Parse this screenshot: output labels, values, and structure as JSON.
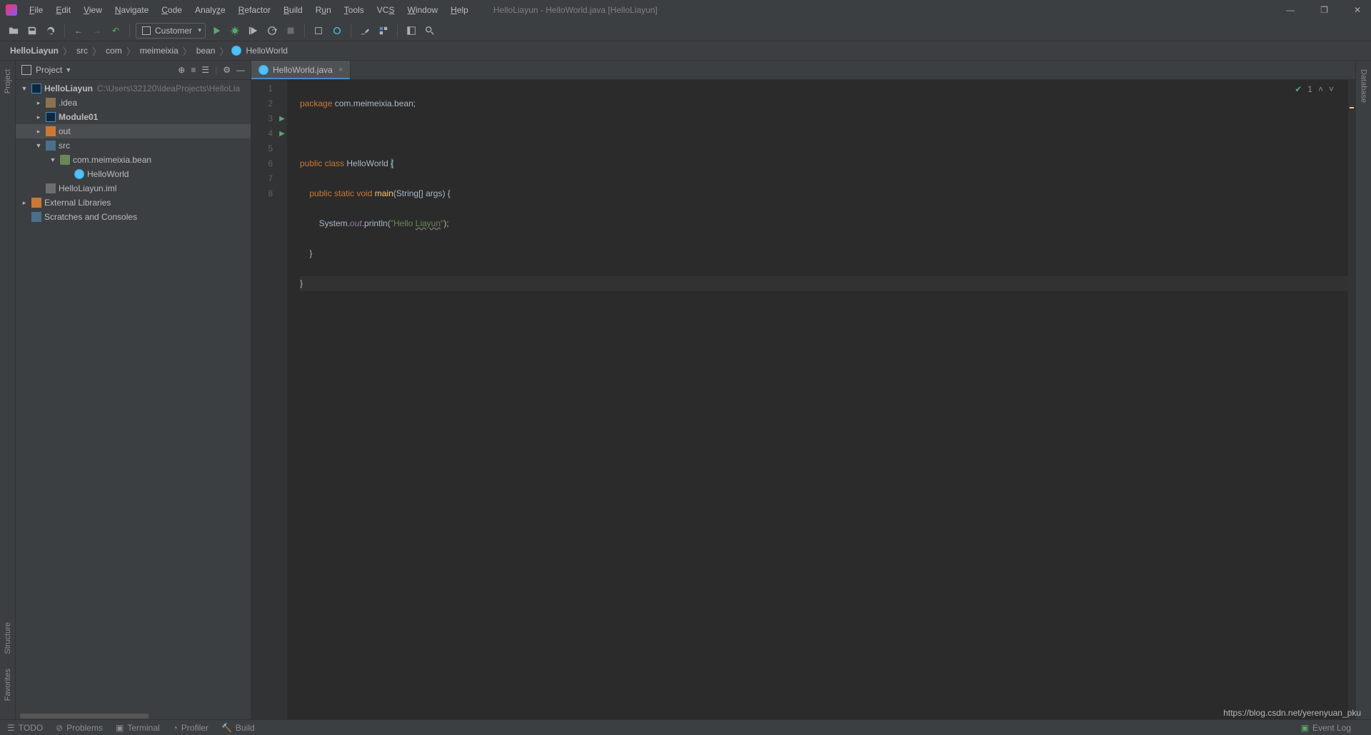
{
  "title": "HelloLiayun - HelloWorld.java [HelloLiayun]",
  "menu": [
    "File",
    "Edit",
    "View",
    "Navigate",
    "Code",
    "Analyze",
    "Refactor",
    "Build",
    "Run",
    "Tools",
    "VCS",
    "Window",
    "Help"
  ],
  "run_config": "Customer",
  "breadcrumbs": [
    "HelloLiayun",
    "src",
    "com",
    "meimeixia",
    "bean",
    "HelloWorld"
  ],
  "project_panel": {
    "title": "Project",
    "tree": {
      "root": {
        "name": "HelloLiayun",
        "path": "C:\\Users\\32120\\IdeaProjects\\HelloLia"
      },
      "idea": ".idea",
      "module01": "Module01",
      "out": "out",
      "src": "src",
      "pkg": "com.meimeixia.bean",
      "cls": "HelloWorld",
      "iml": "HelloLiayun.iml",
      "ext": "External Libraries",
      "scratch": "Scratches and Consoles"
    }
  },
  "tab": {
    "name": "HelloWorld.java"
  },
  "code": {
    "lines": [
      "1",
      "2",
      "3",
      "4",
      "5",
      "6",
      "7",
      "8"
    ],
    "l1_kw": "package",
    "l1_pkg": " com.meimeixia.bean",
    "l1_s": ";",
    "l3_kw1": "public class ",
    "l3_cls": "HelloWorld ",
    "l3_b": "{",
    "l4_ind": "    ",
    "l4_kw": "public static void ",
    "l4_m": "main",
    "l4_p": "(String[] args) {",
    "l5_ind": "        ",
    "l5_a": "System.",
    "l5_out": "out",
    "l5_b": ".println(",
    "l5_s1": "\"Hello ",
    "l5_s2": "Liayun",
    "l5_s3": "\"",
    "l5_c": ");",
    "l6_ind": "    ",
    "l6": "}",
    "l7": "}"
  },
  "overlay": {
    "count": "1"
  },
  "status": {
    "todo": "TODO",
    "problems": "Problems",
    "terminal": "Terminal",
    "profiler": "Profiler",
    "build": "Build",
    "eventlog": "Event Log"
  },
  "sidebars": {
    "project": "Project",
    "structure": "Structure",
    "favorites": "Favorites",
    "database": "Database"
  },
  "watermark": "https://blog.csdn.net/yerenyuan_pku"
}
